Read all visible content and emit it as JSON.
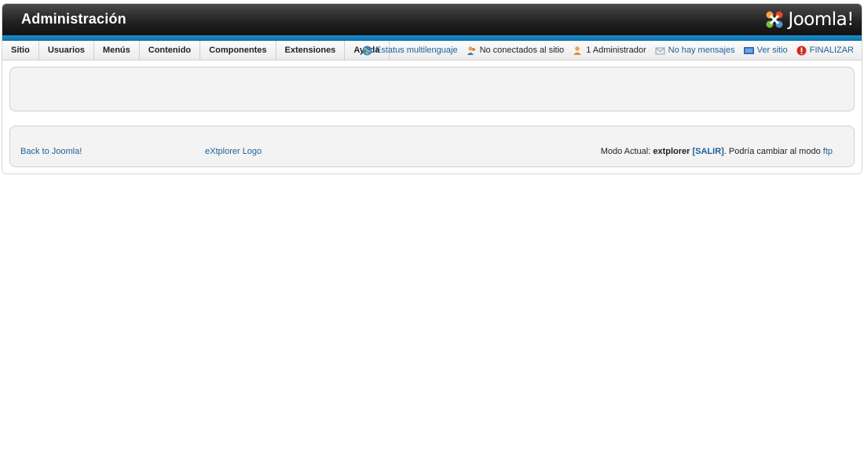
{
  "header": {
    "title": "Administración",
    "logo_text": "Joomla!"
  },
  "menu": {
    "items": [
      "Sitio",
      "Usuarios",
      "Menús",
      "Contenido",
      "Componentes",
      "Extensiones",
      "Ayuda"
    ]
  },
  "status": {
    "multilang": "Estatus multilenguaje",
    "not_connected": "No conectados al sitio",
    "admins": "1 Administrador",
    "messages": "No hay mensajes",
    "view_site": "Ver sitio",
    "logout": "FINALIZAR"
  },
  "footer": {
    "back_link": "Back to Joomla!",
    "logo_link": "eXtplorer Logo",
    "mode_prefix": "Modo Actual: ",
    "mode_value": "extplorer",
    "salir": "[SALIR]",
    "change_text": ". Podría cambiar al modo ",
    "ftp_link": "ftp"
  },
  "colors": {
    "brand_blue": "#1a8fd0",
    "link": "#1f5f98",
    "logout_red": "#d22b1a"
  },
  "icons": [
    "joomla-logo-icon",
    "globe-icon",
    "users-icon",
    "admin-user-icon",
    "mail-icon",
    "monitor-icon",
    "power-icon"
  ]
}
